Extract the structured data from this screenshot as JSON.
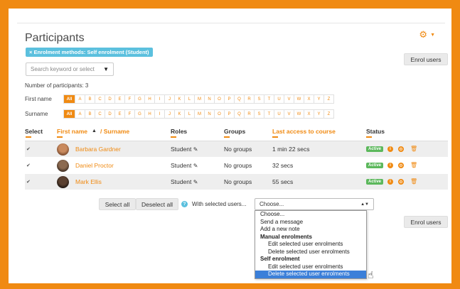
{
  "page": {
    "title": "Participants"
  },
  "filter": {
    "badge": "× Enrolment methods: Self enrolment (Student)"
  },
  "actions": {
    "enrol_users": "Enrol users"
  },
  "search": {
    "placeholder": "Search keyword or select",
    "arrow": "▼"
  },
  "summary": {
    "count_text": "Number of participants: 3"
  },
  "firstname_filter": {
    "label": "First name"
  },
  "surname_filter": {
    "label": "Surname"
  },
  "alphabet": [
    "All",
    "A",
    "B",
    "C",
    "D",
    "E",
    "F",
    "G",
    "H",
    "I",
    "J",
    "K",
    "L",
    "M",
    "N",
    "O",
    "P",
    "Q",
    "R",
    "S",
    "T",
    "U",
    "V",
    "W",
    "X",
    "Y",
    "Z"
  ],
  "table": {
    "headers": {
      "select": "Select",
      "first_name": "First name",
      "sort_arrow": "▲",
      "slash_surname": "/ Surname",
      "roles": "Roles",
      "groups": "Groups",
      "last_access": "Last access to course",
      "status": "Status"
    },
    "rows": [
      {
        "name": "Barbara Gardner",
        "role": "Student",
        "groups": "No groups",
        "last_access": "1 min 22 secs",
        "status": "Active"
      },
      {
        "name": "Daniel Proctor",
        "role": "Student",
        "groups": "No groups",
        "last_access": "32 secs",
        "status": "Active"
      },
      {
        "name": "Mark Ellis",
        "role": "Student",
        "groups": "No groups",
        "last_access": "55 secs",
        "status": "Active"
      }
    ]
  },
  "bulk": {
    "select_all": "Select all",
    "deselect_all": "Deselect all",
    "with_selected": "With selected users...",
    "select_value": "Choose...",
    "options": {
      "choose": "Choose...",
      "send_message": "Send a message",
      "add_note": "Add a new note",
      "group_manual": "Manual enrolments",
      "manual_edit": "Edit selected user enrolments",
      "manual_delete": "Delete selected user enrolments",
      "group_self": "Self enrolment",
      "self_edit": "Edit selected user enrolments",
      "self_delete": "Delete selected user enrolments"
    }
  },
  "colors": {
    "accent": "#f08a12",
    "info": "#5bc0de",
    "success": "#5cb85c",
    "highlight": "#3b7fd9"
  }
}
